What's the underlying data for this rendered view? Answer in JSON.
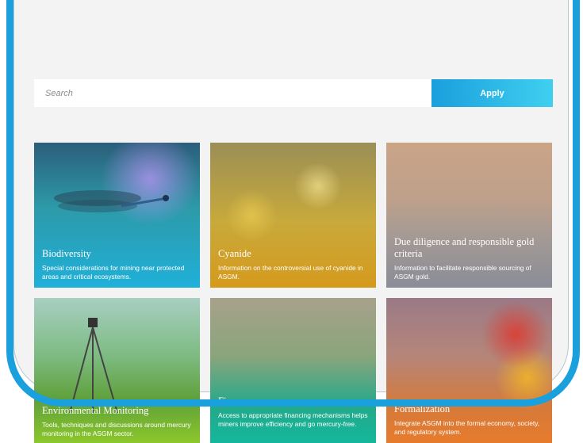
{
  "search": {
    "placeholder": "Search",
    "apply_label": "Apply"
  },
  "cards": [
    {
      "title": "Biodiversity",
      "desc": "Special considerations for mining near protected areas and critical ecosystems."
    },
    {
      "title": "Cyanide",
      "desc": "Information on the controversial use of cyanide in ASGM."
    },
    {
      "title": "Due diligence and responsible gold criteria",
      "desc": "Information to facilitate responsible sourcing of ASGM gold."
    },
    {
      "title": "Environmental Monitoring",
      "desc": "Tools, techniques and discussions around mercury monitoring in the ASGM sector."
    },
    {
      "title": "Finance",
      "desc": "Access to appropriate financing mechanisms helps miners improve efficiency and go mercury-free."
    },
    {
      "title": "Formalization",
      "desc": "Integrate ASGM into the formal economy, society, and regulatory system."
    }
  ],
  "colors": {
    "accent": "#1aa0dd",
    "background": "#f3f3f3"
  }
}
